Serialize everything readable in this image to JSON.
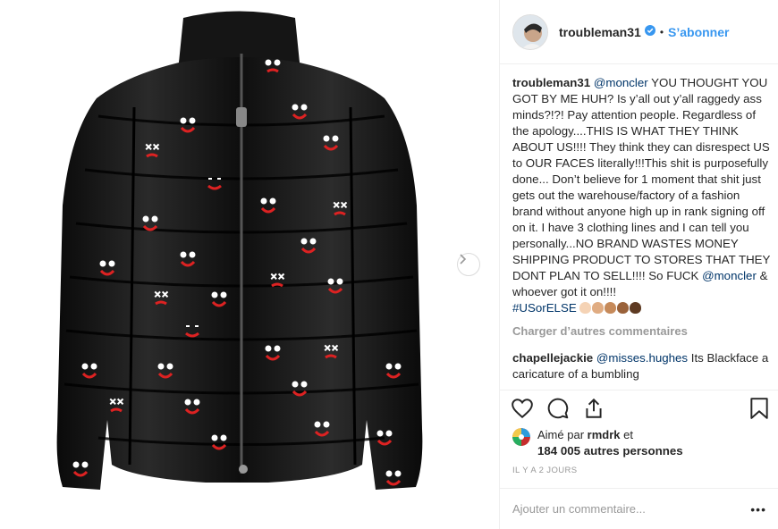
{
  "post": {
    "username": "troubleman31",
    "follow_label": "S’abonner",
    "separator": "•"
  },
  "caption": {
    "username": "troubleman31",
    "mention": "@moncler",
    "text": " YOU THOUGHT YOU GOT BY ME HUH? Is y’all out y’all raggedy ass minds?!?! Pay attention people. Regardless of the apology....THIS IS WHAT THEY THINK ABOUT US!!!! They think they can disrespect US to OUR FACES literally!!!This shit is purposefully done... Don’t believe for 1 moment that shit just gets out the warehouse/factory of a fashion brand without anyone high up in rank signing off on it. I have 3 clothing lines and I can tell you personally...NO BRAND WASTES MONEY SHIPPING PRODUCT TO STORES THAT THEY DONT PLAN TO SELL!!!! So FUCK ",
    "mention2": "@moncler",
    "text2": " & whoever got it on!!!!",
    "hashtag": "#USorELSE",
    "emoji_colors": [
      "#f5d3b5",
      "#e0ac82",
      "#c68a5a",
      "#9a623a",
      "#5e3a22"
    ]
  },
  "load_more": "Charger d’autres commentaires",
  "comments": [
    {
      "username": "chapellejackie",
      "mention": "@misses.hughes",
      "text": " Its Blackface a caricature of a bumbling"
    }
  ],
  "likes": {
    "prefix": "Aimé par ",
    "user": "rmdrk",
    "suffix": " et",
    "count": "184 005 autres personnes"
  },
  "timestamp": "IL Y A 2 JOURS",
  "add_comment": {
    "placeholder": "Ajouter un commentaire...",
    "more": "•••"
  },
  "colors": {
    "accent": "#3897f0",
    "link": "#003569",
    "muted": "#999999"
  },
  "icons": [
    "verified-badge-icon",
    "next-arrow-icon",
    "heart-icon",
    "comment-icon",
    "share-icon",
    "bookmark-icon",
    "more-options-icon"
  ]
}
